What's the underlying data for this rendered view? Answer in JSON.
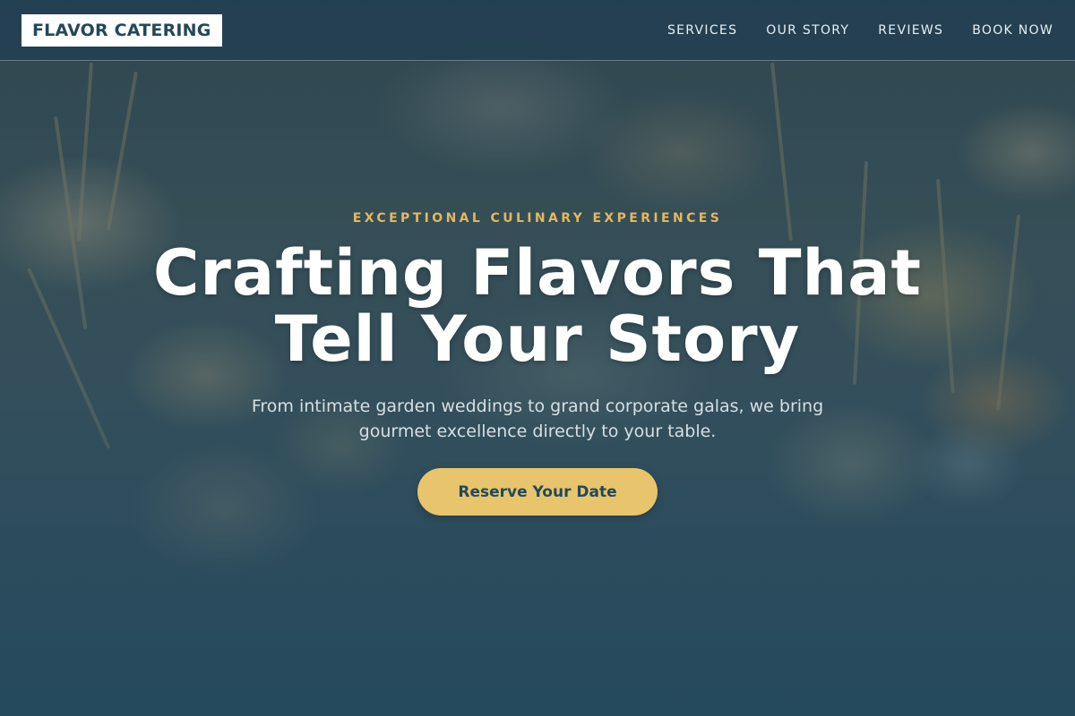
{
  "brand": {
    "logo_text": "FLAVOR CATERING"
  },
  "nav": {
    "items": [
      {
        "label": "SERVICES"
      },
      {
        "label": "OUR STORY"
      },
      {
        "label": "REVIEWS"
      },
      {
        "label": "BOOK NOW"
      }
    ]
  },
  "hero": {
    "eyebrow": "EXCEPTIONAL CULINARY EXPERIENCES",
    "headline_line1": "Crafting Flavors That",
    "headline_line2": "Tell Your Story",
    "subtext": "From intimate garden weddings to grand corporate galas, we bring gourmet excellence directly to your table.",
    "cta_label": "Reserve Your Date",
    "background_image": "catering-appetizers-photo"
  },
  "colors": {
    "brand_dark": "#23485c",
    "accent_gold": "#e8c46c",
    "eyebrow_gold": "#e3b85f",
    "text_light": "#ffffff"
  }
}
